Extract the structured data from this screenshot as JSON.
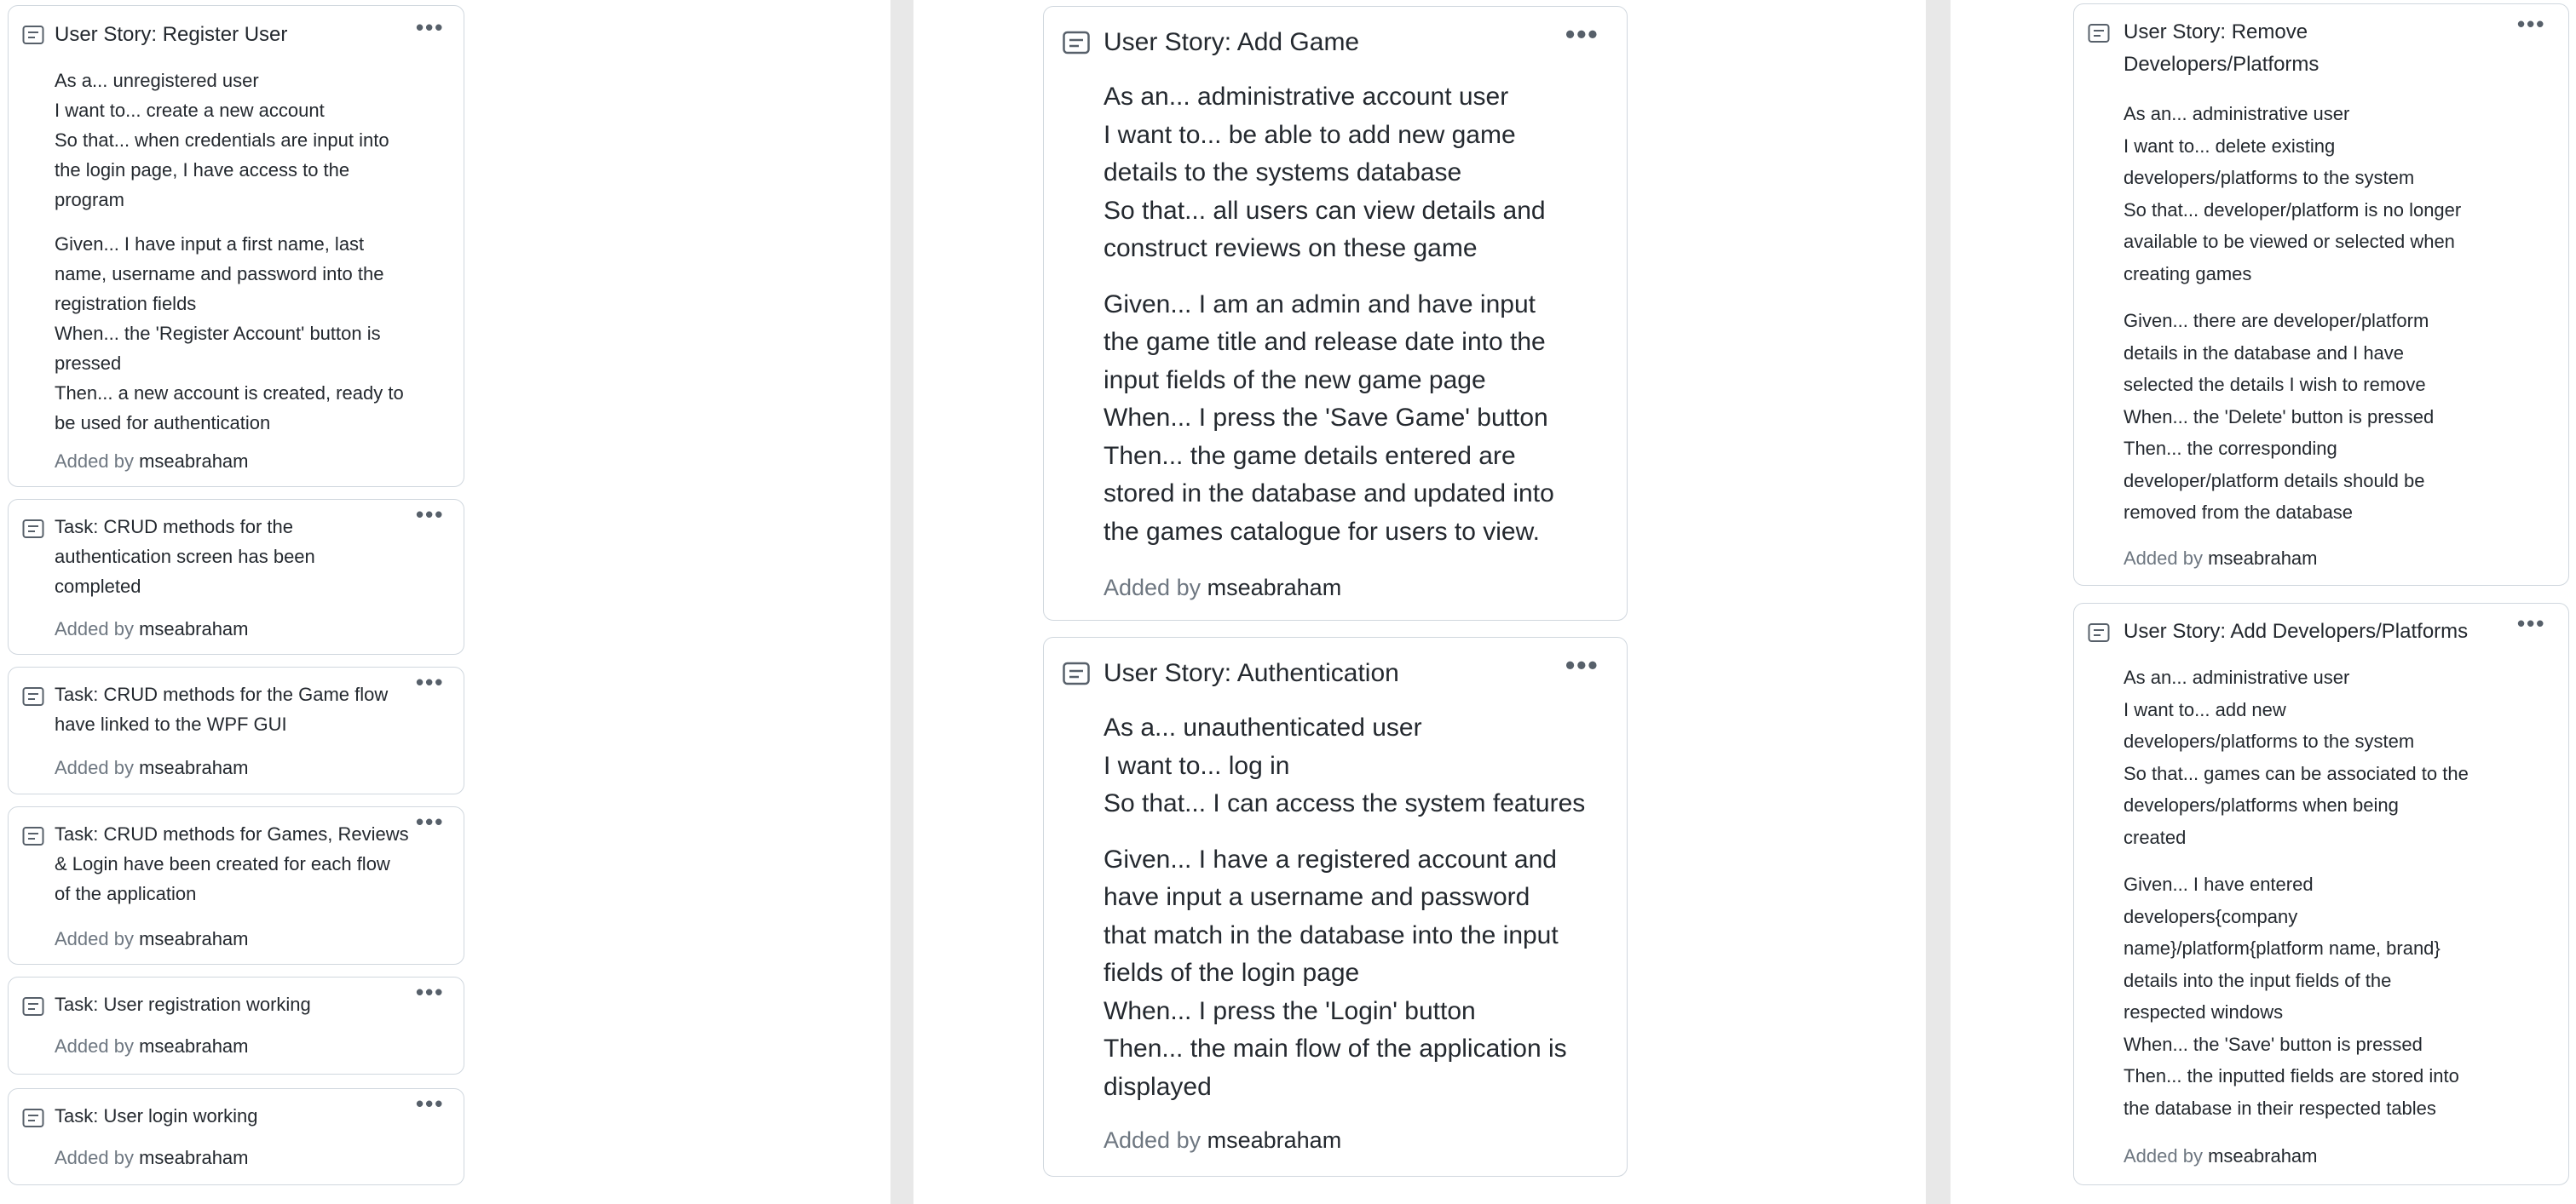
{
  "left_column": [
    {
      "title": "User Story: Register User",
      "paragraphs": [
        [
          "As a... unregistered user",
          "I want to... create a new account",
          "So that... when credentials are input into",
          "the login page, I have access to the",
          "program"
        ],
        [
          "Given... I have input a first name, last",
          "name, username and password into the",
          "registration fields",
          "When... the 'Register Account' button is",
          "pressed",
          "Then... a new account is created, ready to",
          "be used for authentication"
        ]
      ],
      "added_prefix": "Added by",
      "added_user": "mseabraham"
    },
    {
      "title": "Task: CRUD methods for the authentication screen has been completed",
      "title_lines": [
        "Task: CRUD methods for the",
        "authentication screen has been",
        "completed"
      ],
      "added_prefix": "Added by",
      "added_user": "mseabraham"
    },
    {
      "title_lines": [
        "Task: CRUD methods for the Game flow",
        "have linked to the WPF GUI"
      ],
      "added_prefix": "Added by",
      "added_user": "mseabraham"
    },
    {
      "title_lines": [
        "Task: CRUD methods for Games, Reviews",
        "& Login have been created for each flow",
        "of the application"
      ],
      "added_prefix": "Added by",
      "added_user": "mseabraham"
    },
    {
      "title_lines": [
        "Task: User registration working"
      ],
      "added_prefix": "Added by",
      "added_user": "mseabraham"
    },
    {
      "title_lines": [
        "Task: User login working"
      ],
      "added_prefix": "Added by",
      "added_user": "mseabraham"
    }
  ],
  "middle_column": [
    {
      "title": "User Story: Add Game",
      "paragraphs": [
        [
          "As an... administrative account user",
          "I want to... be able to add new game",
          "details to the systems database",
          "So that... all users can view details and",
          "construct reviews on these game"
        ],
        [
          "Given... I am an admin and have input",
          "the game title and release date into the",
          "input fields of the new game page",
          "When... I press the 'Save Game' button",
          "Then... the game details entered are",
          "stored in the database and updated into",
          "the games catalogue for users to view."
        ]
      ],
      "added_prefix": "Added by",
      "added_user": "mseabraham"
    },
    {
      "title": "User Story: Authentication",
      "paragraphs": [
        [
          "As a... unauthenticated user",
          "I want to... log in",
          "So that... I can access the system features"
        ],
        [
          "Given... I have a registered account and",
          "have input a username and password",
          "that match in the database into the input",
          "fields of the login page",
          "When... I press the 'Login' button",
          "Then... the main flow of the application is",
          "displayed"
        ]
      ],
      "added_prefix": "Added by",
      "added_user": "mseabraham"
    }
  ],
  "right_column": [
    {
      "title_lines": [
        "User Story: Remove",
        "Developers/Platforms"
      ],
      "paragraphs": [
        [
          "As an... administrative user",
          "I want to... delete existing",
          "developers/platforms to the system",
          "So that... developer/platform is no longer",
          "available to be viewed or selected when",
          "creating games"
        ],
        [
          "Given... there are developer/platform",
          "details in the database and I have",
          "selected the details I wish to remove",
          "When... the 'Delete' button is pressed",
          "Then... the corresponding",
          "developer/platform details should be",
          "removed from the database"
        ]
      ],
      "added_prefix": "Added by",
      "added_user": "mseabraham"
    },
    {
      "title_lines": [
        "User Story: Add Developers/Platforms"
      ],
      "paragraphs": [
        [
          "As an... administrative user",
          "I want to... add new",
          "developers/platforms to the system",
          "So that... games can be associated to the",
          "developers/platforms when being",
          "created"
        ],
        [
          "Given... I have entered",
          "developers{company",
          "name}/platform{platform name, brand}",
          "details into the input fields of the",
          "respected windows",
          "When... the 'Save' button is pressed",
          "Then... the inputted fields are stored into",
          "the database in their respected tables"
        ]
      ],
      "added_prefix": "Added by",
      "added_user": "mseabraham"
    }
  ],
  "more_label": "•••",
  "icons": {
    "card": "note-icon",
    "more": "more-options-icon"
  },
  "colors": {
    "column_gap": "#e8e8e8",
    "border": "#d0d7de",
    "muted": "#6e7781"
  }
}
